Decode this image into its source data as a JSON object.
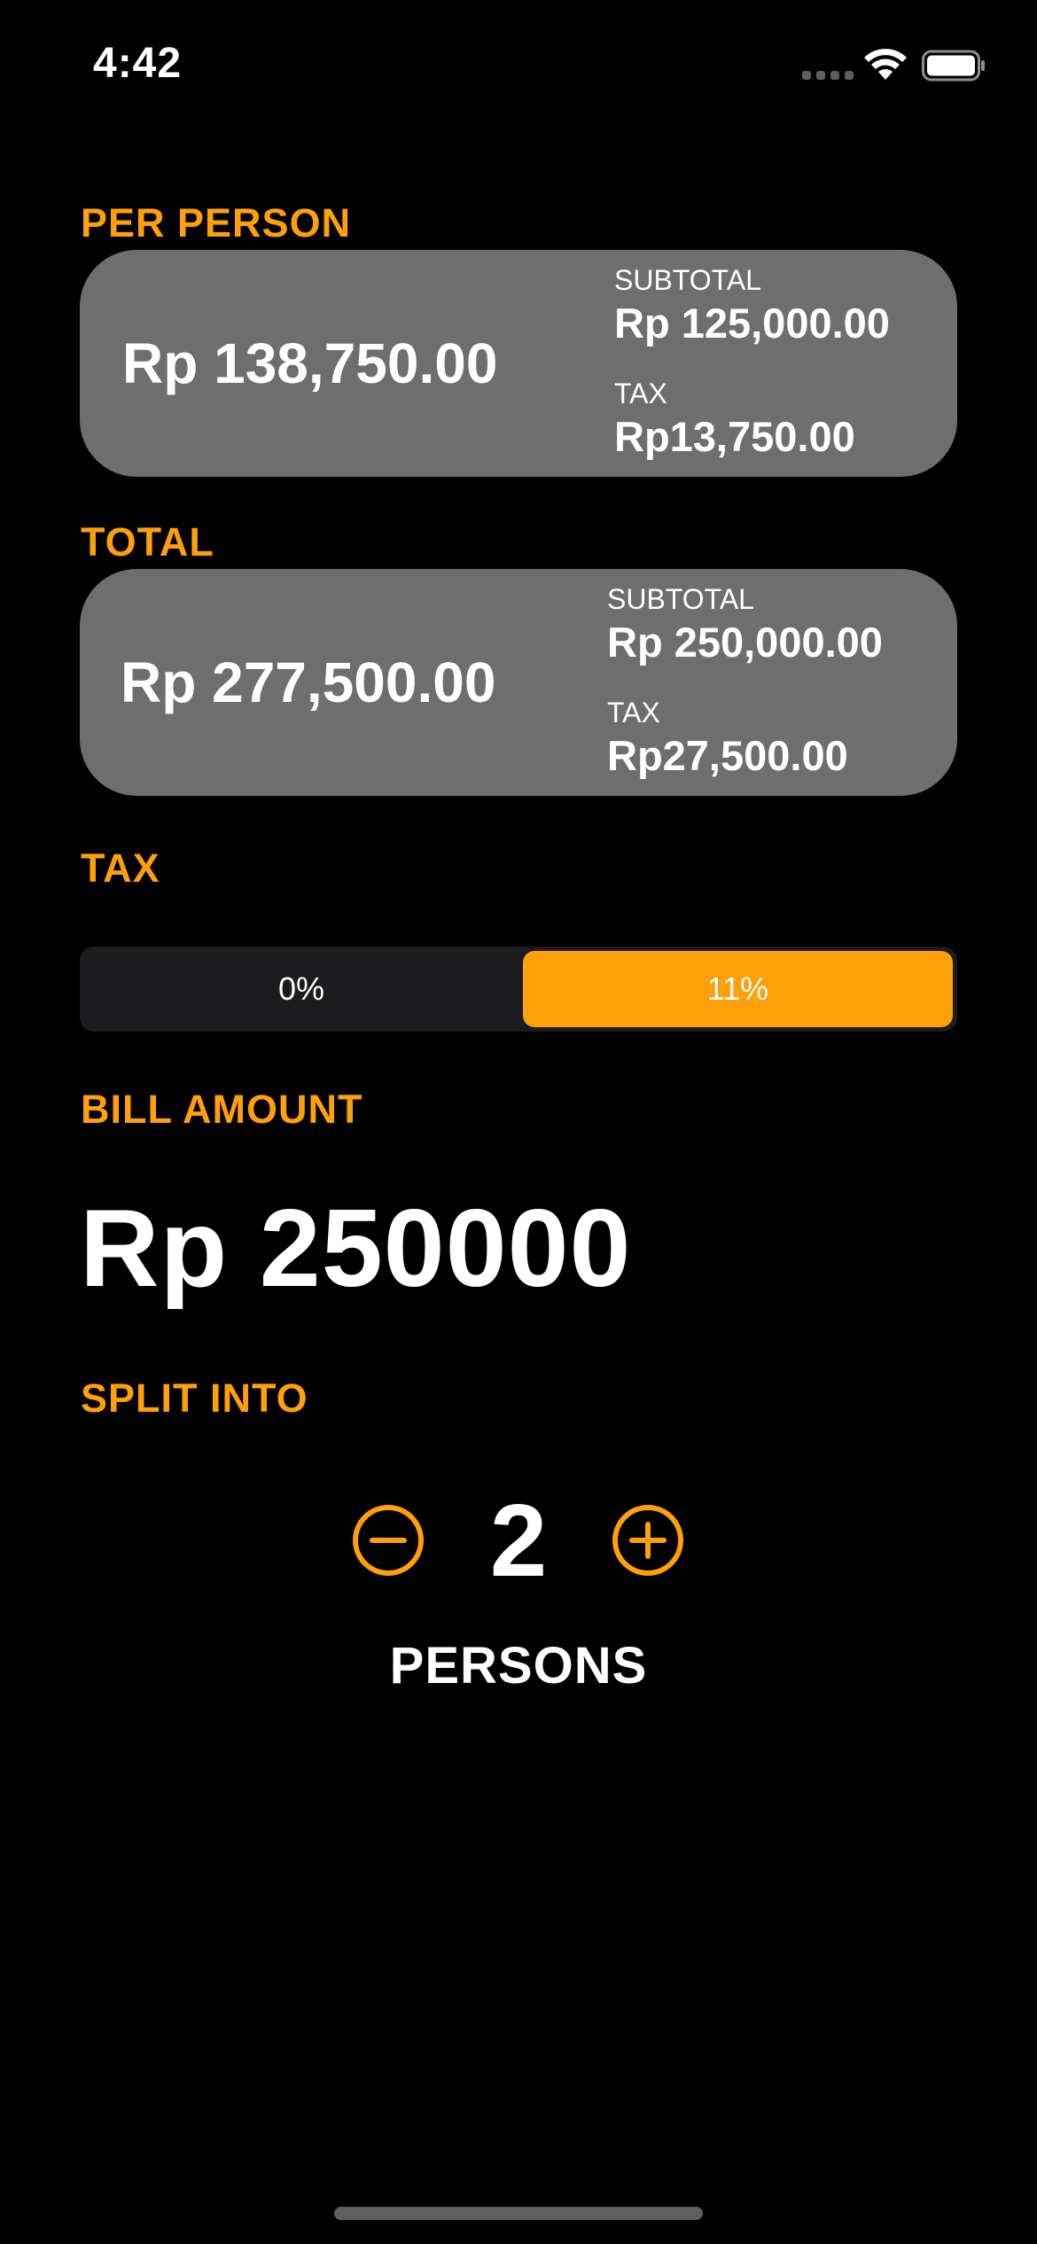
{
  "status_bar": {
    "time": "4:42"
  },
  "per_person": {
    "label": "PER PERSON",
    "total": "Rp 138,750.00",
    "subtotal_label": "SUBTOTAL",
    "subtotal_value": "Rp 125,000.00",
    "tax_label": "TAX",
    "tax_value": "Rp13,750.00"
  },
  "total": {
    "label": "TOTAL",
    "total": "Rp 277,500.00",
    "subtotal_label": "SUBTOTAL",
    "subtotal_value": "Rp 250,000.00",
    "tax_label": "TAX",
    "tax_value": "Rp27,500.00"
  },
  "tax": {
    "label": "TAX",
    "options": [
      "0%",
      "11%"
    ],
    "selected": "11%"
  },
  "bill": {
    "label": "BILL AMOUNT",
    "value": "Rp 250000"
  },
  "split": {
    "label": "SPLIT INTO",
    "count": "2",
    "unit": "PERSONS"
  },
  "colors": {
    "accent": "#ff9f0a",
    "card": "#6e6e6e",
    "background": "#000000",
    "segment_bg": "#1c1c1e"
  },
  "icons": {
    "minus": "minus-circle-icon",
    "plus": "plus-circle-icon",
    "wifi": "wifi-icon",
    "battery": "battery-icon"
  }
}
